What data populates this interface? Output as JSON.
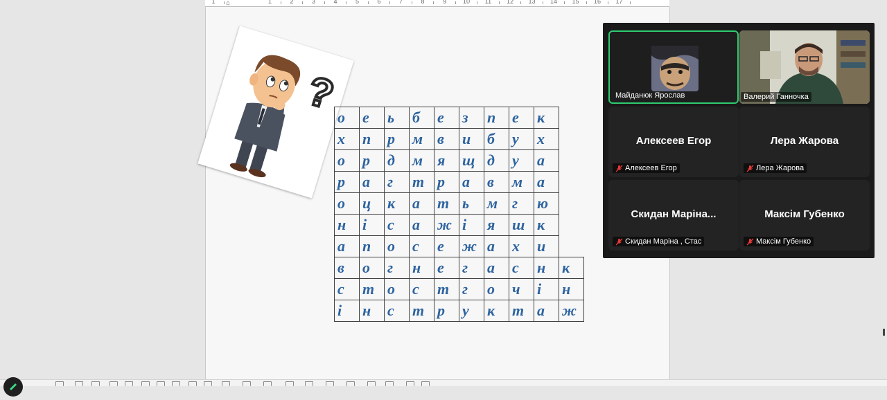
{
  "ruler": {
    "numbers": [
      "1",
      "1",
      "2",
      "3",
      "4",
      "5",
      "6",
      "7",
      "8",
      "9",
      "10",
      "11",
      "12",
      "13",
      "14",
      "15",
      "16",
      "17"
    ]
  },
  "puzzle": {
    "rows": [
      [
        "о",
        "е",
        "ь",
        "б",
        "е",
        "з",
        "п",
        "е",
        "к",
        ""
      ],
      [
        "х",
        "п",
        "р",
        "м",
        "в",
        "и",
        "б",
        "у",
        "х",
        ""
      ],
      [
        "о",
        "р",
        "д",
        "м",
        "я",
        "щ",
        "д",
        "у",
        "а",
        ""
      ],
      [
        "р",
        "а",
        "г",
        "т",
        "р",
        "а",
        "в",
        "м",
        "а",
        ""
      ],
      [
        "о",
        "ц",
        "к",
        "а",
        "т",
        "ь",
        "м",
        "г",
        "ю",
        ""
      ],
      [
        "н",
        "і",
        "с",
        "а",
        "ж",
        "і",
        "я",
        "ш",
        "к",
        ""
      ],
      [
        "а",
        "п",
        "о",
        "с",
        "е",
        "ж",
        "а",
        "х",
        "и",
        ""
      ],
      [
        "в",
        "о",
        "г",
        "н",
        "е",
        "г",
        "а",
        "с",
        "н",
        "к"
      ],
      [
        "с",
        "т",
        "о",
        "с",
        "т",
        "г",
        "о",
        "ч",
        "і",
        "н"
      ],
      [
        "і",
        "н",
        "с",
        "т",
        "р",
        "у",
        "к",
        "т",
        "а",
        "ж"
      ]
    ]
  },
  "participants": [
    {
      "name": "Майданюк Ярослав",
      "active": true
    },
    {
      "name": "Валерий Ганночка"
    },
    {
      "display": "Алексеев Егор",
      "name": "Алексеев Егор",
      "muted": true
    },
    {
      "display": "Лера Жарова",
      "name": "Лера Жарова",
      "muted": true
    },
    {
      "display": "Скидан Маріна...",
      "name": "Скидан Маріна , Стас",
      "muted": true
    },
    {
      "display": "Максім Губенко",
      "name": "Максім Губенко",
      "muted": true
    }
  ],
  "colors": {
    "grid_letters": "#2e64a0",
    "active_speaker_border": "#2ecc71",
    "muted_mic": "#e53935"
  },
  "icons": {
    "clipart": "thinking-boy-question-mark",
    "mic": "mic-muted-icon",
    "draw": "pen-icon"
  }
}
